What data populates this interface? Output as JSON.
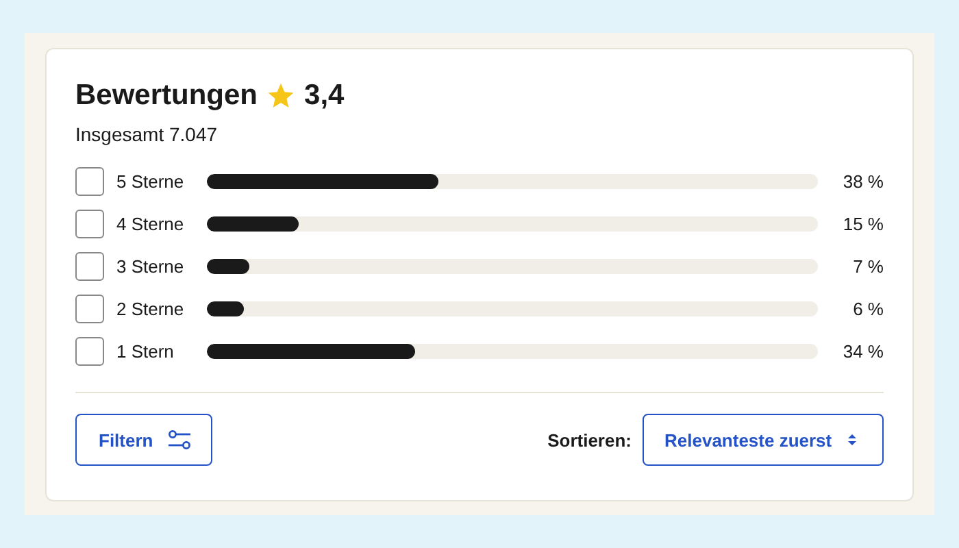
{
  "header": {
    "title": "Bewertungen",
    "rating": "3,4",
    "total": "Insgesamt 7.047"
  },
  "rows": [
    {
      "label": "5 Sterne",
      "checked": false,
      "level": 0.38,
      "percent": "38 %"
    },
    {
      "label": "4 Sterne",
      "checked": false,
      "level": 0.15,
      "percent": "15 %"
    },
    {
      "label": "3 Sterne",
      "checked": false,
      "level": 0.07,
      "percent": "7 %"
    },
    {
      "label": "2 Sterne",
      "checked": false,
      "level": 0.06,
      "percent": "6 %"
    },
    {
      "label": "1 Stern",
      "checked": false,
      "level": 0.34,
      "percent": "34 %"
    }
  ],
  "footer": {
    "filter_button": "Filtern",
    "sort_label": "Sortieren:",
    "sort_value": "Relevanteste zuerst"
  }
}
